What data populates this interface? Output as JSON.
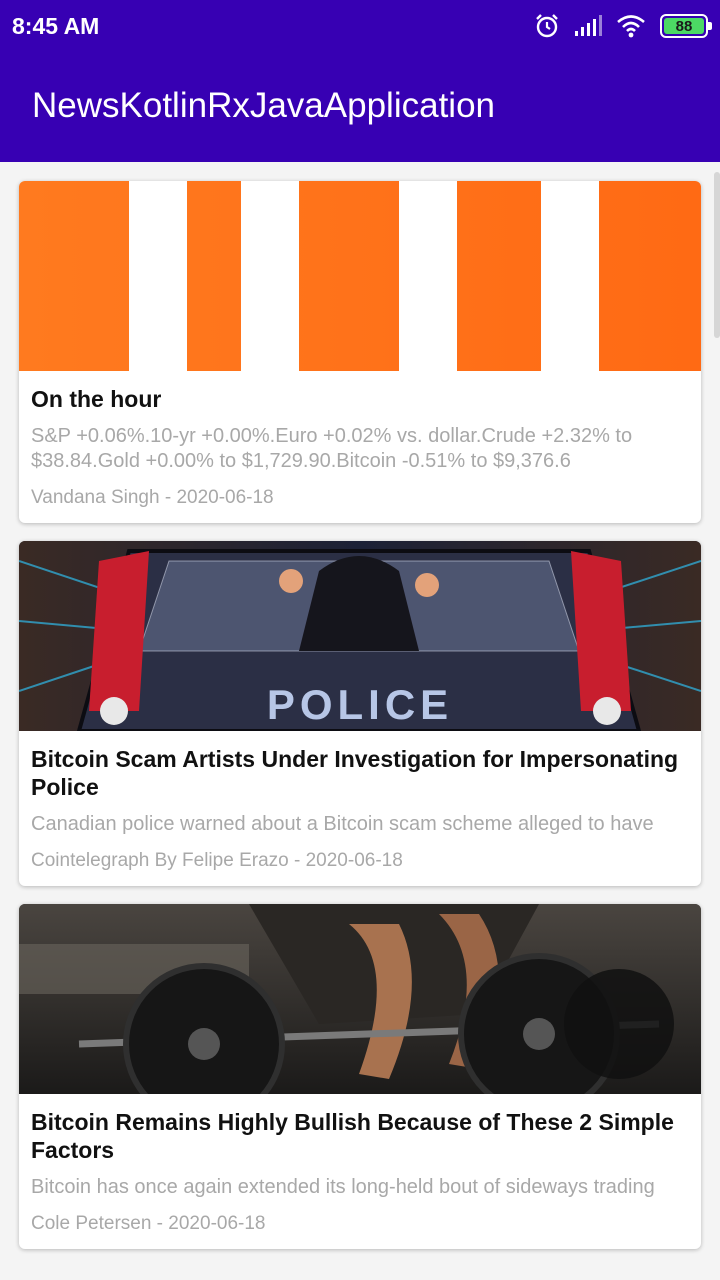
{
  "status_bar": {
    "time": "8:45 AM",
    "battery": "88"
  },
  "app_bar": {
    "title": "NewsKotlinRxJavaApplication"
  },
  "articles": [
    {
      "title": "On the hour",
      "description": "S&P +0.06%.10-yr +0.00%.Euro +0.02% vs. dollar.Crude +2.32% to $38.84.Gold +0.00% to $1,729.90.Bitcoin -0.51% to $9,376.6",
      "author": "Vandana Singh",
      "date": "2020-06-18",
      "separator": " - "
    },
    {
      "title": "Bitcoin Scam Artists Under Investigation for Impersonating Police",
      "description": "Canadian police warned about a Bitcoin scam scheme alleged to have",
      "author": "Cointelegraph By Felipe Erazo",
      "date": "2020-06-18",
      "separator": " - ",
      "image_text": "POLICE"
    },
    {
      "title": "Bitcoin Remains Highly Bullish Because of These 2 Simple Factors",
      "description": "Bitcoin has once again extended its long-held bout of sideways trading",
      "author": "Cole Petersen",
      "date": "2020-06-18",
      "separator": " - "
    }
  ],
  "colors": {
    "primary": "#3700b3",
    "battery": "#4cd964"
  }
}
